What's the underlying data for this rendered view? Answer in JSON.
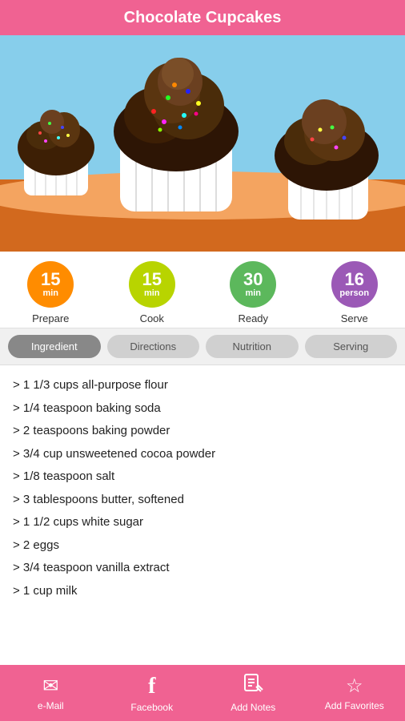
{
  "header": {
    "title": "Chocolate Cupcakes"
  },
  "stats": [
    {
      "id": "prepare",
      "number": "15",
      "unit": "min",
      "label": "Prepare",
      "color_class": "orange"
    },
    {
      "id": "cook",
      "number": "15",
      "unit": "min",
      "label": "Cook",
      "color_class": "yellow-green"
    },
    {
      "id": "ready",
      "number": "30",
      "unit": "min",
      "label": "Ready",
      "color_class": "green"
    },
    {
      "id": "serve",
      "number": "16",
      "unit": "person",
      "label": "Serve",
      "color_class": "purple"
    }
  ],
  "tabs": [
    {
      "id": "ingredient",
      "label": "Ingredient",
      "active": true
    },
    {
      "id": "directions",
      "label": "Directions",
      "active": false
    },
    {
      "id": "nutrition",
      "label": "Nutrition",
      "active": false
    },
    {
      "id": "serving",
      "label": "Serving",
      "active": false
    }
  ],
  "ingredients": [
    "> 1 1/3 cups all-purpose flour",
    "> 1/4 teaspoon baking soda",
    "> 2 teaspoons baking powder",
    "> 3/4 cup unsweetened cocoa powder",
    "> 1/8 teaspoon salt",
    "> 3 tablespoons butter, softened",
    "> 1 1/2 cups white sugar",
    "> 2 eggs",
    "> 3/4 teaspoon vanilla extract",
    "> 1 cup milk"
  ],
  "bottom_nav": [
    {
      "id": "email",
      "icon": "✉",
      "label": "e-Mail"
    },
    {
      "id": "facebook",
      "icon": "f",
      "label": "Facebook"
    },
    {
      "id": "add-notes",
      "icon": "📝",
      "label": "Add Notes"
    },
    {
      "id": "add-favorites",
      "icon": "☆",
      "label": "Add Favorites"
    }
  ]
}
